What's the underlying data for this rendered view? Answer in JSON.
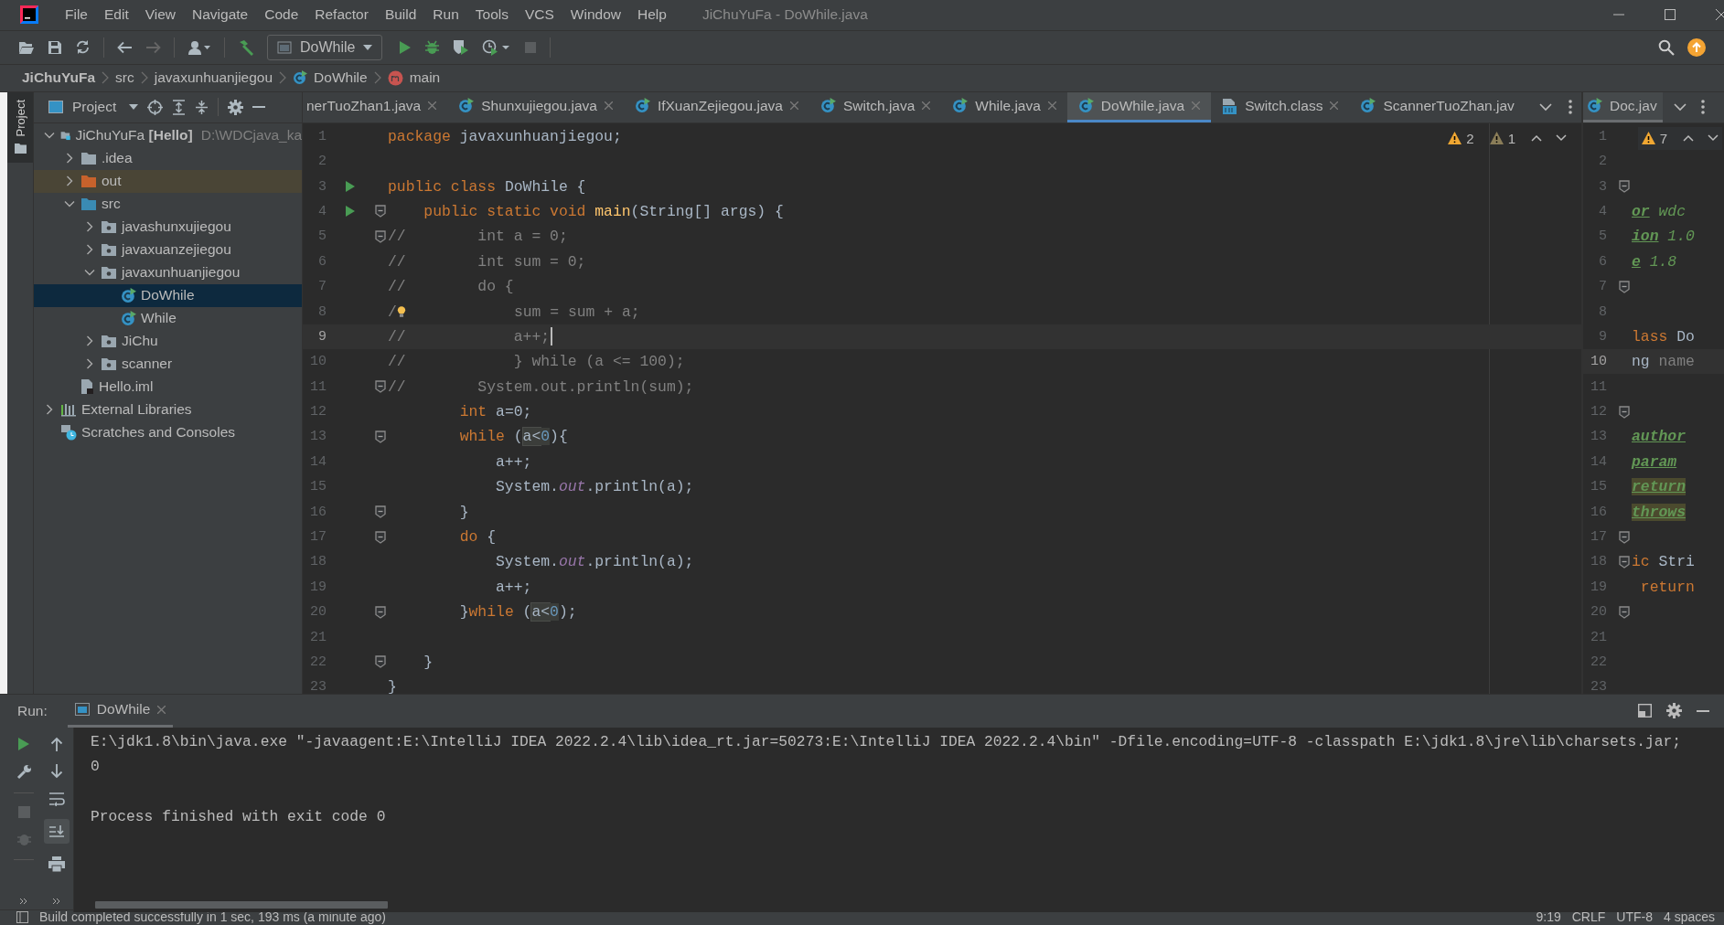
{
  "window": {
    "title": "JiChuYuFa - DoWhile.java"
  },
  "menu": [
    "File",
    "Edit",
    "View",
    "Navigate",
    "Code",
    "Refactor",
    "Build",
    "Run",
    "Tools",
    "VCS",
    "Window",
    "Help"
  ],
  "toolbar": {
    "run_configuration": "DoWhile"
  },
  "breadcrumbs": [
    {
      "kind": "project",
      "label": "JiChuYuFa"
    },
    {
      "kind": "folder",
      "label": "src"
    },
    {
      "kind": "folder",
      "label": "javaxunhuanjiegou"
    },
    {
      "kind": "class",
      "label": "DoWhile"
    },
    {
      "kind": "method",
      "label": "main"
    }
  ],
  "side_stripe": {
    "label": "Project"
  },
  "project": {
    "title": "Project",
    "tree": [
      {
        "kind": "module",
        "label": "JiChuYuFa **[Hello]**",
        "hint": "D:\\WDCjava_ka",
        "expanded": true,
        "selected": false,
        "children": [
          {
            "kind": "folder",
            "label": ".idea",
            "expanded": false,
            "selected": false
          },
          {
            "kind": "excluded",
            "label": "out",
            "expanded": false,
            "selected": false
          },
          {
            "kind": "source",
            "label": "src",
            "expanded": true,
            "selected": false,
            "children": [
              {
                "kind": "package",
                "label": "javashunxujiegou",
                "expanded": false,
                "selected": false
              },
              {
                "kind": "package",
                "label": "javaxuanzejiegou",
                "expanded": false,
                "selected": false
              },
              {
                "kind": "package",
                "label": "javaxunhuanjiegou",
                "expanded": true,
                "selected": false,
                "children": [
                  {
                    "kind": "class",
                    "label": "DoWhile",
                    "selected": true
                  },
                  {
                    "kind": "class",
                    "label": "While",
                    "selected": false
                  }
                ]
              },
              {
                "kind": "package",
                "label": "JiChu",
                "expanded": false,
                "selected": false
              },
              {
                "kind": "package",
                "label": "scanner",
                "expanded": false,
                "selected": false
              }
            ]
          },
          {
            "kind": "file",
            "label": "Hello.iml",
            "selected": false
          }
        ]
      },
      {
        "kind": "libraries",
        "label": "External Libraries",
        "expanded": false,
        "selected": false
      },
      {
        "kind": "scratches",
        "label": "Scratches and Consoles",
        "selected": false
      }
    ]
  },
  "tabs": [
    {
      "kind": "none",
      "label": "nerTuoZhan1.java",
      "selected": false,
      "closable": true
    },
    {
      "kind": "class",
      "label": "Shunxujiegou.java",
      "selected": false,
      "closable": true
    },
    {
      "kind": "class",
      "label": "IfXuanZejiegou.java",
      "selected": false,
      "closable": true
    },
    {
      "kind": "class",
      "label": "Switch.java",
      "selected": false,
      "closable": true
    },
    {
      "kind": "class",
      "label": "While.java",
      "selected": false,
      "closable": true
    },
    {
      "kind": "class",
      "label": "DoWhile.java",
      "selected": true,
      "closable": true
    },
    {
      "kind": "compiled",
      "label": "Switch.class",
      "selected": false,
      "closable": true
    },
    {
      "kind": "class",
      "label": "ScannerTuoZhan.jav",
      "selected": false,
      "closable": false
    }
  ],
  "editor": {
    "focused": true,
    "warnings": "2",
    "weak_warnings": "1",
    "lines": [
      {
        "number": "1",
        "run": false,
        "fold": false,
        "current": false,
        "tokens": [
          {
            "kind": "kw",
            "text": "package"
          },
          {
            "kind": "plain",
            "text": " javaxunhuanjiegou;"
          }
        ]
      },
      {
        "number": "2",
        "run": false,
        "fold": false,
        "current": false
      },
      {
        "number": "3",
        "run": true,
        "fold": false,
        "current": false,
        "tokens": [
          {
            "kind": "kw",
            "text": "public class"
          },
          {
            "kind": "plain",
            "text": " DoWhile {"
          }
        ]
      },
      {
        "number": "4",
        "run": true,
        "fold": true,
        "current": false,
        "tokens": [
          {
            "kind": "kw",
            "text": "    public static void "
          },
          {
            "kind": "method",
            "text": "main"
          },
          {
            "kind": "plain",
            "text": "(String[] args) {"
          }
        ]
      },
      {
        "number": "5",
        "run": false,
        "fold": true,
        "current": false,
        "tokens": [
          {
            "kind": "comment",
            "text": "//        int a = 0;"
          }
        ]
      },
      {
        "number": "6",
        "run": false,
        "fold": false,
        "current": false,
        "tokens": [
          {
            "kind": "comment",
            "text": "//        int sum = 0;"
          }
        ]
      },
      {
        "number": "7",
        "run": false,
        "fold": false,
        "current": false,
        "tokens": [
          {
            "kind": "comment",
            "text": "//        do {"
          }
        ]
      },
      {
        "number": "8",
        "run": false,
        "fold": false,
        "current": false,
        "tokens": [
          {
            "kind": "comment",
            "text": "/"
          },
          {
            "kind": "bulb"
          },
          {
            "kind": "comment",
            "text": "            sum = sum + a;"
          }
        ]
      },
      {
        "number": "9",
        "run": false,
        "fold": false,
        "current": true,
        "tokens": [
          {
            "kind": "comment",
            "text": "//            a++;"
          }
        ]
      },
      {
        "number": "10",
        "run": false,
        "fold": false,
        "current": false,
        "tokens": [
          {
            "kind": "comment",
            "text": "//            } while (a <= 100);"
          }
        ]
      },
      {
        "number": "11",
        "run": false,
        "fold": true,
        "current": false,
        "tokens": [
          {
            "kind": "comment",
            "text": "//        System.out.println(sum);"
          }
        ]
      },
      {
        "number": "12",
        "run": false,
        "fold": false,
        "current": false,
        "tokens": [
          {
            "kind": "kw",
            "text": "        int"
          },
          {
            "kind": "plain",
            "text": " a=0;"
          }
        ]
      },
      {
        "number": "13",
        "run": false,
        "fold": true,
        "current": false,
        "tokens": [
          {
            "kind": "kw",
            "text": "        while"
          },
          {
            "kind": "plain",
            "text": " ("
          },
          {
            "kind": "match",
            "text": "a<"
          },
          {
            "kind": "match-num",
            "text": "0"
          },
          {
            "kind": "plain",
            "text": "){"
          }
        ]
      },
      {
        "number": "14",
        "run": false,
        "fold": false,
        "current": false,
        "tokens": [
          {
            "kind": "plain",
            "text": "            a++;"
          }
        ]
      },
      {
        "number": "15",
        "run": false,
        "fold": false,
        "current": false,
        "tokens": [
          {
            "kind": "plain",
            "text": "            System."
          },
          {
            "kind": "field",
            "text": "out"
          },
          {
            "kind": "plain",
            "text": ".println(a);"
          }
        ]
      },
      {
        "number": "16",
        "run": false,
        "fold": true,
        "current": false,
        "tokens": [
          {
            "kind": "plain",
            "text": "        }"
          }
        ]
      },
      {
        "number": "17",
        "run": false,
        "fold": true,
        "current": false,
        "tokens": [
          {
            "kind": "kw",
            "text": "        do"
          },
          {
            "kind": "plain",
            "text": " {"
          }
        ]
      },
      {
        "number": "18",
        "run": false,
        "fold": false,
        "current": false,
        "tokens": [
          {
            "kind": "plain",
            "text": "            System."
          },
          {
            "kind": "field",
            "text": "out"
          },
          {
            "kind": "plain",
            "text": ".println(a);"
          }
        ]
      },
      {
        "number": "19",
        "run": false,
        "fold": false,
        "current": false,
        "tokens": [
          {
            "kind": "plain",
            "text": "            a++;"
          }
        ]
      },
      {
        "number": "20",
        "run": false,
        "fold": true,
        "current": false,
        "tokens": [
          {
            "kind": "plain",
            "text": "        }"
          },
          {
            "kind": "kw",
            "text": "while"
          },
          {
            "kind": "plain",
            "text": " ("
          },
          {
            "kind": "match",
            "text": "a<"
          },
          {
            "kind": "match-num",
            "text": "0"
          },
          {
            "kind": "plain",
            "text": ");"
          }
        ]
      },
      {
        "number": "21",
        "run": false,
        "fold": false,
        "current": false
      },
      {
        "number": "22",
        "run": false,
        "fold": true,
        "current": false,
        "tokens": [
          {
            "kind": "plain",
            "text": "    }"
          }
        ]
      },
      {
        "number": "23",
        "run": false,
        "fold": false,
        "current": false,
        "tokens": [
          {
            "kind": "plain",
            "text": "}"
          }
        ]
      }
    ]
  },
  "split_tab": {
    "kind": "class",
    "label": "Doc.jav",
    "selected": true
  },
  "split_editor": {
    "focused": false,
    "warnings": "7",
    "lines": [
      {
        "number": "1",
        "run": false,
        "fold": false,
        "current": false
      },
      {
        "number": "2",
        "run": false,
        "fold": false,
        "current": false
      },
      {
        "number": "3",
        "run": false,
        "fold": true,
        "current": false
      },
      {
        "number": "4",
        "run": false,
        "fold": false,
        "current": false,
        "tokens": [
          {
            "kind": "doctag",
            "text": "or"
          },
          {
            "kind": "doc",
            "text": " wdc"
          }
        ]
      },
      {
        "number": "5",
        "run": false,
        "fold": false,
        "current": false,
        "tokens": [
          {
            "kind": "doctag",
            "text": "ion"
          },
          {
            "kind": "doc",
            "text": " 1.0"
          }
        ]
      },
      {
        "number": "6",
        "run": false,
        "fold": false,
        "current": false,
        "tokens": [
          {
            "kind": "doctag",
            "text": "e"
          },
          {
            "kind": "doc",
            "text": " 1.8"
          }
        ]
      },
      {
        "number": "7",
        "run": false,
        "fold": true,
        "current": false
      },
      {
        "number": "8",
        "run": false,
        "fold": false,
        "current": false
      },
      {
        "number": "9",
        "run": false,
        "fold": false,
        "current": false,
        "tokens": [
          {
            "kind": "kw",
            "text": "lass"
          },
          {
            "kind": "plain",
            "text": " Do"
          }
        ]
      },
      {
        "number": "10",
        "run": false,
        "fold": false,
        "current": true,
        "tokens": [
          {
            "kind": "plain",
            "text": "ng "
          },
          {
            "kind": "dim",
            "text": "name"
          }
        ]
      },
      {
        "number": "11",
        "run": false,
        "fold": false,
        "current": false
      },
      {
        "number": "12",
        "run": false,
        "fold": true,
        "current": false
      },
      {
        "number": "13",
        "run": false,
        "fold": false,
        "current": false,
        "tokens": [
          {
            "kind": "doctag",
            "text": "author"
          }
        ]
      },
      {
        "number": "14",
        "run": false,
        "fold": false,
        "current": false,
        "tokens": [
          {
            "kind": "doctag",
            "text": "param"
          }
        ]
      },
      {
        "number": "15",
        "run": false,
        "fold": false,
        "current": false,
        "tokens": [
          {
            "kind": "doctag-match",
            "text": "return"
          }
        ]
      },
      {
        "number": "16",
        "run": false,
        "fold": false,
        "current": false,
        "tokens": [
          {
            "kind": "doctag-match",
            "text": "throws"
          }
        ]
      },
      {
        "number": "17",
        "run": false,
        "fold": true,
        "current": false
      },
      {
        "number": "18",
        "run": false,
        "fold": true,
        "current": false,
        "tokens": [
          {
            "kind": "kw",
            "text": "ic"
          },
          {
            "kind": "plain",
            "text": " Stri"
          }
        ]
      },
      {
        "number": "19",
        "run": false,
        "fold": false,
        "current": false,
        "tokens": [
          {
            "kind": "kw",
            "text": " return"
          }
        ]
      },
      {
        "number": "20",
        "run": false,
        "fold": true,
        "current": false
      },
      {
        "number": "21",
        "run": false,
        "fold": false,
        "current": false
      },
      {
        "number": "22",
        "run": false,
        "fold": false,
        "current": false
      },
      {
        "number": "23",
        "run": false,
        "fold": false,
        "current": false
      }
    ]
  },
  "run_panel": {
    "title": "Run:",
    "tab": "DoWhile",
    "console": [
      "E:\\jdk1.8\\bin\\java.exe \"-javaagent:E:\\IntelliJ IDEA 2022.2.4\\lib\\idea_rt.jar=50273:E:\\IntelliJ IDEA 2022.2.4\\bin\" -Dfile.encoding=UTF-8 -classpath E:\\jdk1.8\\jre\\lib\\charsets.jar;",
      "0",
      "Process finished with exit code 0"
    ]
  },
  "status_bar": {
    "message": "Build completed successfully in 1 sec, 193 ms (a minute ago)",
    "position": "9:19",
    "line_separator": "CRLF",
    "encoding": "UTF-8",
    "indent": "4 spaces"
  }
}
